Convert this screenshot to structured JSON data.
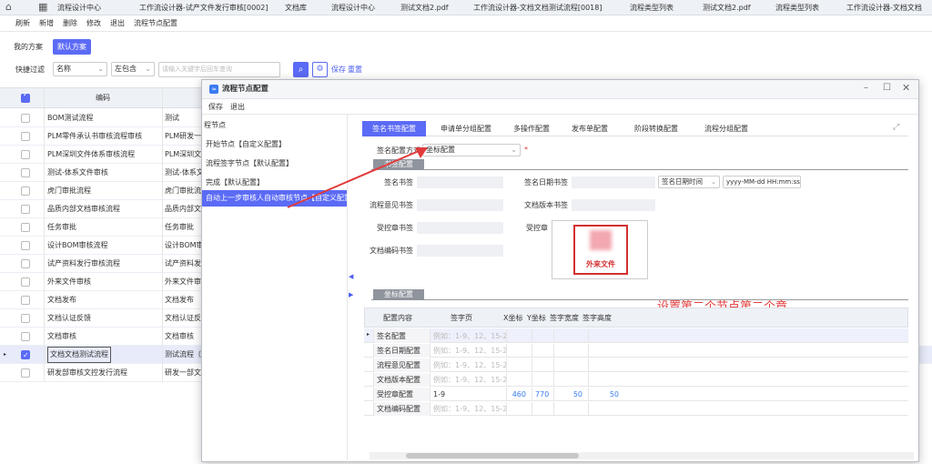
{
  "top_tabs": [
    "流程设计中心",
    "工作流设计器-试产文件发行审核[0002]",
    "文档库",
    "流程设计中心",
    "测试文档2.pdf",
    "工作流设计器-文档文档测试流程[0018]",
    "流程类型列表",
    "测试文档2.pdf",
    "流程类型列表",
    "工作流设计器-文档文档"
  ],
  "toolbar": [
    "刷新",
    "新增",
    "删除",
    "修改",
    "退出",
    "流程节点配置"
  ],
  "scheme": {
    "mine": "我的方案",
    "default": "默认方案"
  },
  "filter": {
    "label": "快捷过滤",
    "field": "名称",
    "op": "左包含",
    "placeholder": "请输入关键字后回车查询",
    "save": "保存",
    "reset": "重置"
  },
  "table": {
    "header": "编码",
    "rows": [
      {
        "c1": "BOM测试流程",
        "c2": "测试",
        "checked": false
      },
      {
        "c1": "PLM零件承认书审核流程审核",
        "c2": "PLM研发一",
        "checked": false
      },
      {
        "c1": "PLM深圳文件体系审核流程",
        "c2": "PLM深圳文",
        "checked": false
      },
      {
        "c1": "测试-体系文件审核",
        "c2": "测试-体系文",
        "checked": false
      },
      {
        "c1": "虎门审批流程",
        "c2": "虎门审批流",
        "checked": false
      },
      {
        "c1": "品质内部文档审核流程",
        "c2": "品质内部文",
        "checked": false
      },
      {
        "c1": "任务审批",
        "c2": "任务审批",
        "checked": false
      },
      {
        "c1": "设计BOM审核流程",
        "c2": "设计BOM审",
        "checked": false
      },
      {
        "c1": "试产资料发行审核流程",
        "c2": "试产资料发",
        "checked": false
      },
      {
        "c1": "外来文件审核",
        "c2": "外来文件审",
        "checked": false
      },
      {
        "c1": "文档发布",
        "c2": "文档发布",
        "checked": false
      },
      {
        "c1": "文档认证反馈",
        "c2": "文档认证反",
        "checked": false
      },
      {
        "c1": "文档审核",
        "c2": "文档审核",
        "checked": false
      },
      {
        "c1": "文档文档测试流程",
        "c2": "测试流程（",
        "checked": true
      },
      {
        "c1": "研发部审核文控发行流程",
        "c2": "研发一部文",
        "checked": false
      }
    ]
  },
  "dialog": {
    "title": "流程节点配置",
    "toolbar": [
      "保存",
      "退出"
    ],
    "tree": [
      "程节点",
      "开始节点【自定义配置】",
      "流程签字节点【默认配置】",
      "完成【默认配置】",
      "自动上一步审核人自动审核节点【自定义配置】"
    ],
    "tabs": [
      "签名书签配置",
      "申请单分组配置",
      "多操作配置",
      "发布单配置",
      "阶段转换配置",
      "流程分组配置"
    ],
    "sign_mode_label": "签名配置方式",
    "sign_mode_value": "坐标配置",
    "required_mark": "*",
    "section_bookmark": "书签配置",
    "fields": {
      "sign_bookmark": "签名书签",
      "opinion_bookmark": "流程意见书签",
      "controlled_bookmark": "受控章书签",
      "docno_bookmark": "文档编码书签",
      "date_bookmark": "签名日期书签",
      "version_bookmark": "文档版本书签",
      "controlled_stamp": "受控章",
      "date_type": "签名日期时间",
      "date_format": "yyyy-MM-dd HH:mm:ss"
    },
    "stamp_text": "外来文件",
    "section_coord": "坐标配置",
    "annotation": "设置第二个节点第二个章",
    "grid": {
      "headers": [
        "配置内容",
        "签字页",
        "X坐标",
        "Y坐标",
        "签字宽度",
        "签字高度"
      ],
      "rows": [
        {
          "name": "签名配置",
          "page": "例如：1-9、12、15-20",
          "x": "",
          "y": "",
          "w": "",
          "h": "",
          "ph": true
        },
        {
          "name": "签名日期配置",
          "page": "例如：1-9、12、15-20",
          "x": "",
          "y": "",
          "w": "",
          "h": "",
          "ph": true
        },
        {
          "name": "流程意见配置",
          "page": "例如：1-9、12、15-20",
          "x": "",
          "y": "",
          "w": "",
          "h": "",
          "ph": true
        },
        {
          "name": "文档版本配置",
          "page": "例如：1-9、12、15-20",
          "x": "",
          "y": "",
          "w": "",
          "h": "",
          "ph": true
        },
        {
          "name": "受控章配置",
          "page": "1-9",
          "x": "460",
          "y": "770",
          "w": "50",
          "h": "50",
          "ph": false
        },
        {
          "name": "文档编码配置",
          "page": "例如：1-9、12、15-20",
          "x": "",
          "y": "",
          "w": "",
          "h": "",
          "ph": true
        }
      ]
    }
  },
  "colors": {
    "accent": "#5b6bf5",
    "annotation": "#e23b3b",
    "stamp": "#d32f2f"
  }
}
